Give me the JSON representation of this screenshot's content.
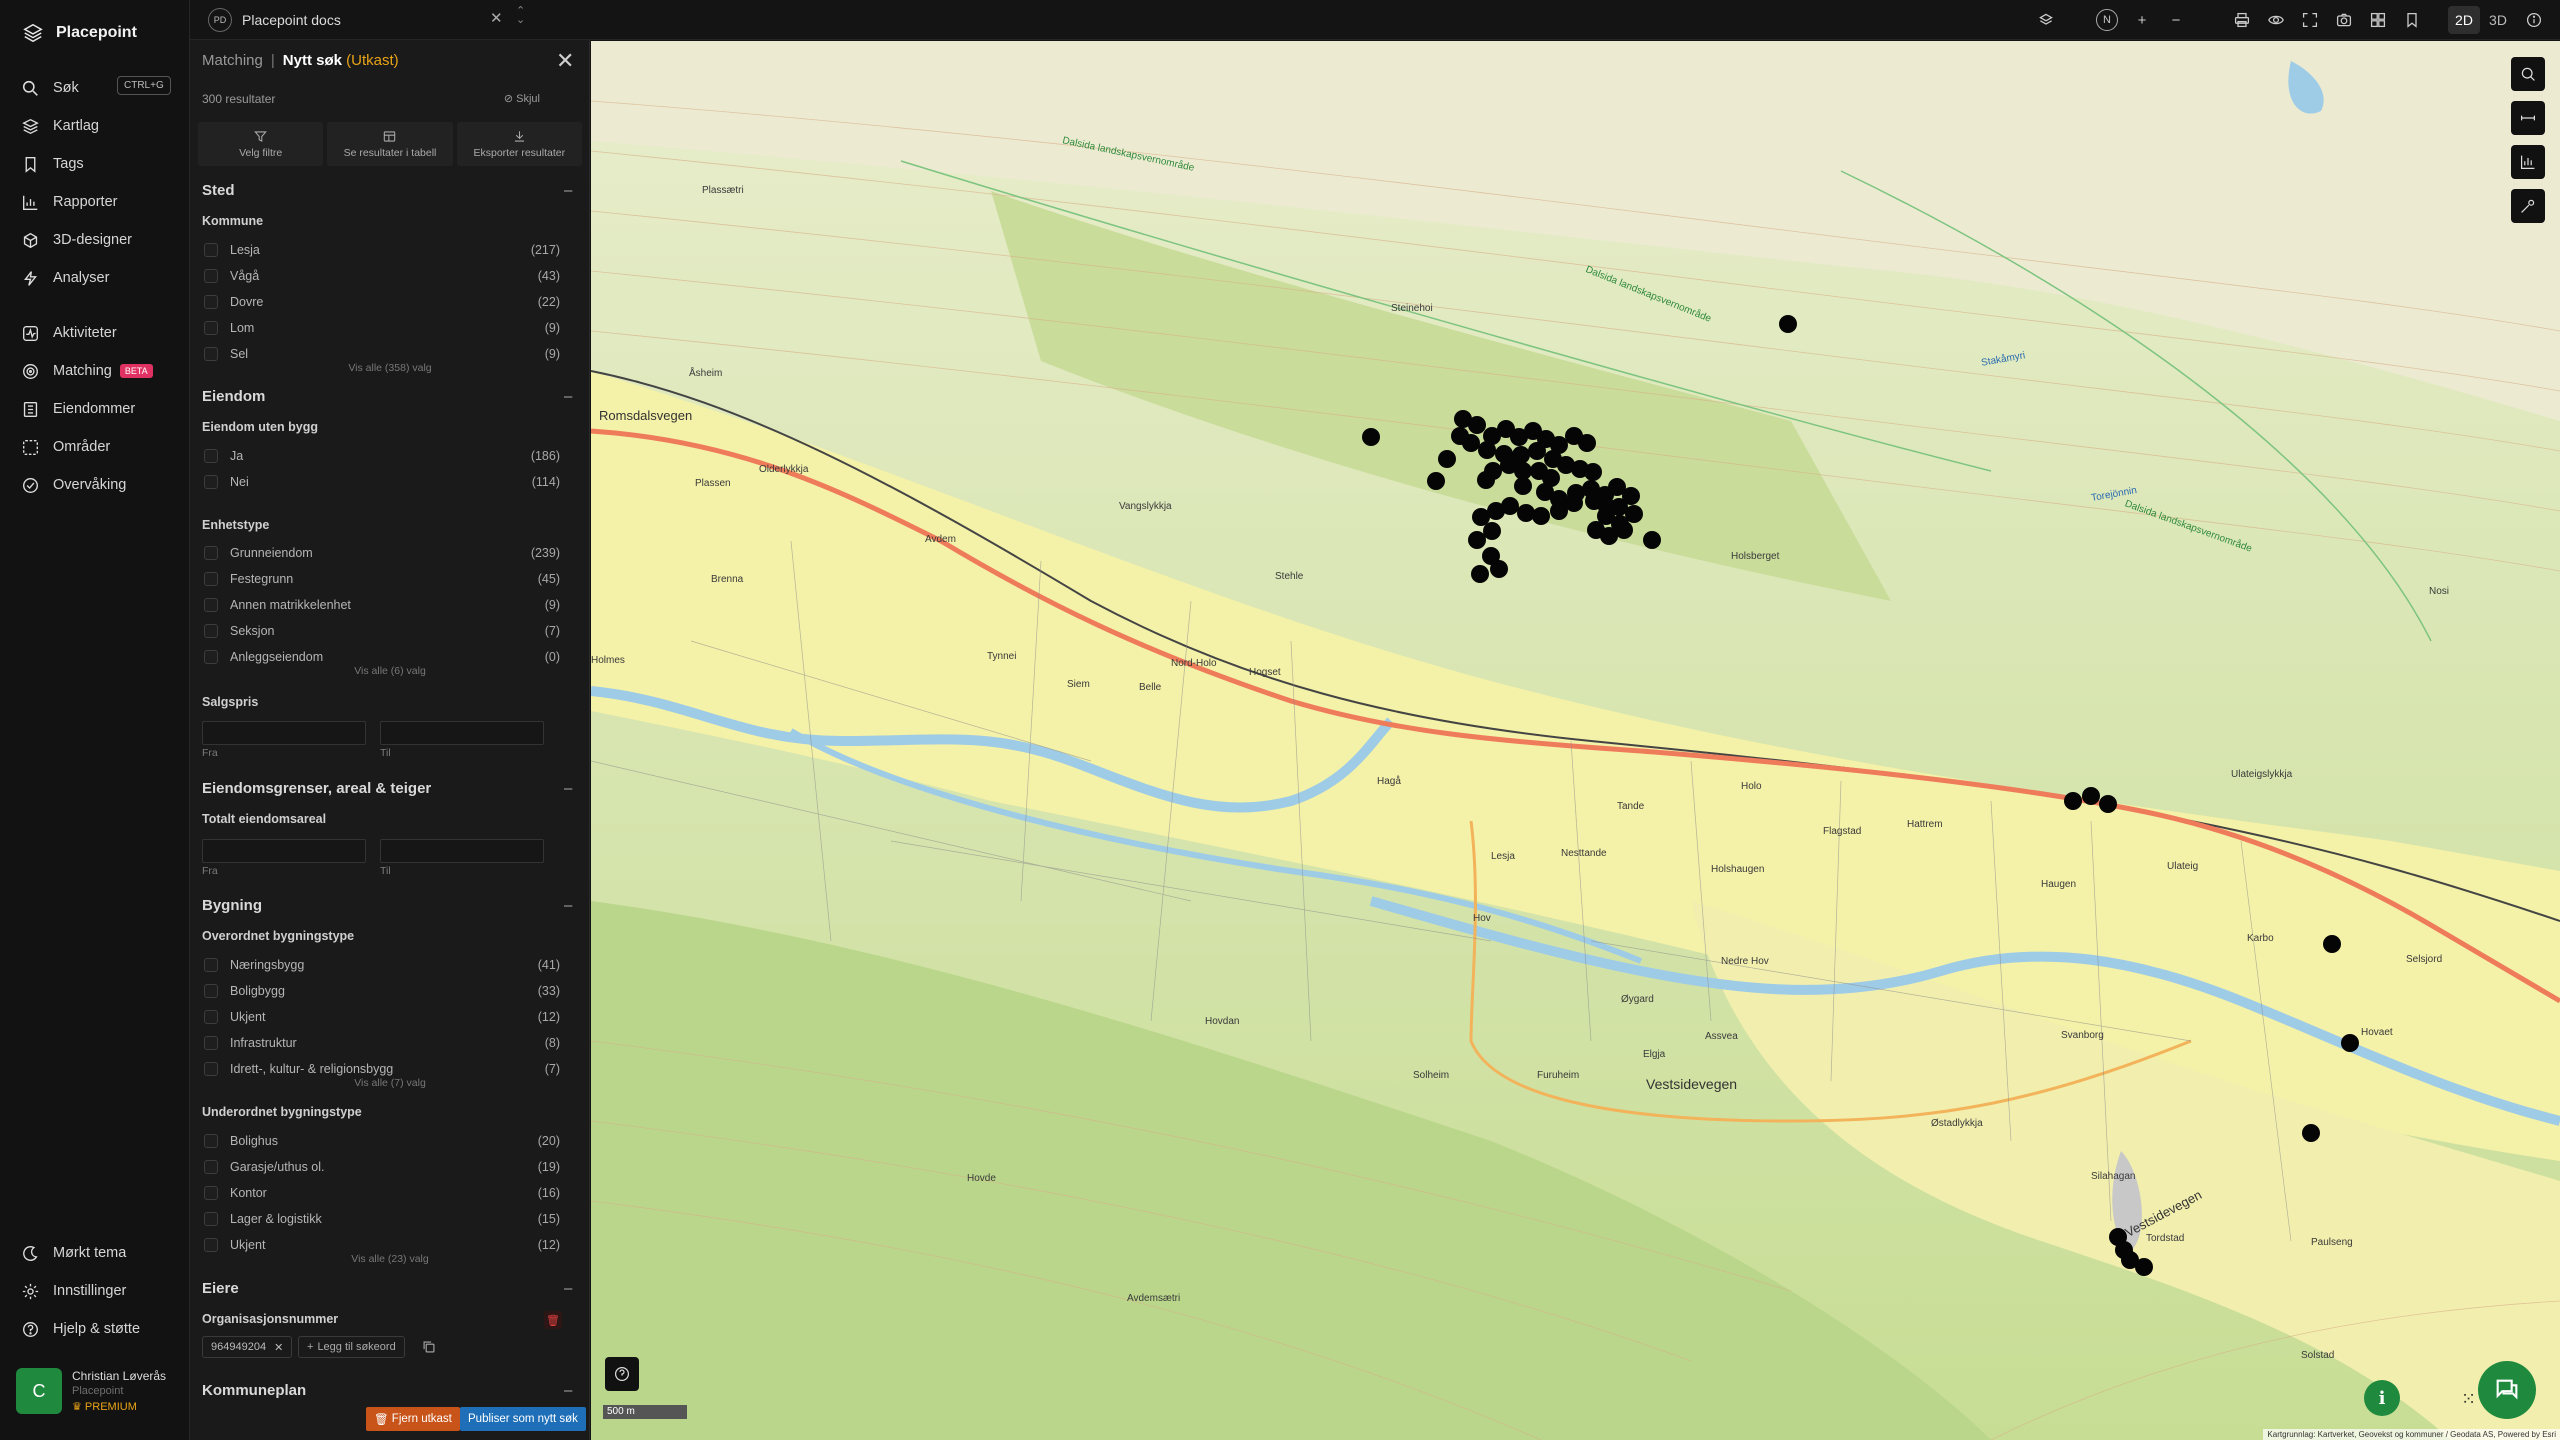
{
  "app": {
    "name": "Placepoint"
  },
  "nav": {
    "items": [
      {
        "label": "Søk",
        "icon": "search-icon",
        "shortcut": "CTRL+G"
      },
      {
        "label": "Kartlag",
        "icon": "layers-icon"
      },
      {
        "label": "Tags",
        "icon": "bookmark-icon"
      },
      {
        "label": "Rapporter",
        "icon": "chart-icon"
      },
      {
        "label": "3D-designer",
        "icon": "cube-icon"
      },
      {
        "label": "Analyser",
        "icon": "bolt-icon"
      },
      {
        "label": "Aktiviteter",
        "icon": "activity-icon"
      },
      {
        "label": "Matching",
        "icon": "target-icon",
        "badge": "BETA"
      },
      {
        "label": "Eiendommer",
        "icon": "building-icon"
      },
      {
        "label": "Områder",
        "icon": "area-icon"
      },
      {
        "label": "Overvåking",
        "icon": "monitor-icon"
      }
    ],
    "bottom": [
      {
        "label": "Mørkt tema",
        "icon": "moon-icon"
      },
      {
        "label": "Innstillinger",
        "icon": "gear-icon"
      },
      {
        "label": "Hjelp & støtte",
        "icon": "help-icon"
      }
    ],
    "user": {
      "initial": "C",
      "name": "Christian Løverås",
      "org": "Placepoint",
      "plan": "PREMIUM"
    }
  },
  "topbar": {
    "workspace_badge": "PD",
    "workspace": "Placepoint docs",
    "compass": "N",
    "mode_2d": "2D",
    "mode_3d": "3D"
  },
  "panel": {
    "crumb_parent": "Matching",
    "crumb_sep": "|",
    "crumb_current": "Nytt søk",
    "crumb_status": "(Utkast)",
    "result_count": "300 resultater",
    "hide_label": "Skjul",
    "actions": [
      "Velg filtre",
      "Se resultater i tabell",
      "Eksporter resultater"
    ],
    "sections": {
      "sted": {
        "title": "Sted",
        "kommune_title": "Kommune",
        "kommune": [
          {
            "label": "Lesja",
            "count": "(217)"
          },
          {
            "label": "Vågå",
            "count": "(43)"
          },
          {
            "label": "Dovre",
            "count": "(22)"
          },
          {
            "label": "Lom",
            "count": "(9)"
          },
          {
            "label": "Sel",
            "count": "(9)"
          }
        ],
        "kommune_more": "Vis alle (358) valg"
      },
      "eiendom": {
        "title": "Eiendom",
        "uten_bygg_title": "Eiendom uten bygg",
        "uten_bygg": [
          {
            "label": "Ja",
            "count": "(186)"
          },
          {
            "label": "Nei",
            "count": "(114)"
          }
        ],
        "enhetstype_title": "Enhetstype",
        "enhetstype": [
          {
            "label": "Grunneiendom",
            "count": "(239)"
          },
          {
            "label": "Festegrunn",
            "count": "(45)"
          },
          {
            "label": "Annen matrikkelenhet",
            "count": "(9)"
          },
          {
            "label": "Seksjon",
            "count": "(7)"
          },
          {
            "label": "Anleggseiendom",
            "count": "(0)"
          }
        ],
        "enhetstype_more": "Vis alle (6) valg",
        "salgspris_title": "Salgspris",
        "from": "Fra",
        "to": "Til"
      },
      "grenser": {
        "title": "Eiendomsgrenser, areal & teiger",
        "areal_title": "Totalt eiendomsareal",
        "from": "Fra",
        "to": "Til"
      },
      "bygning": {
        "title": "Bygning",
        "overordnet_title": "Overordnet bygningstype",
        "overordnet": [
          {
            "label": "Næringsbygg",
            "count": "(41)"
          },
          {
            "label": "Boligbygg",
            "count": "(33)"
          },
          {
            "label": "Ukjent",
            "count": "(12)"
          },
          {
            "label": "Infrastruktur",
            "count": "(8)"
          },
          {
            "label": "Idrett-, kultur- & religionsbygg",
            "count": "(7)"
          }
        ],
        "overordnet_more": "Vis alle (7) valg",
        "underordnet_title": "Underordnet bygningstype",
        "underordnet": [
          {
            "label": "Bolighus",
            "count": "(20)"
          },
          {
            "label": "Garasje/uthus ol.",
            "count": "(19)"
          },
          {
            "label": "Kontor",
            "count": "(16)"
          },
          {
            "label": "Lager & logistikk",
            "count": "(15)"
          },
          {
            "label": "Ukjent",
            "count": "(12)"
          }
        ],
        "underordnet_more": "Vis alle (23) valg"
      },
      "eiere": {
        "title": "Eiere",
        "org_title": "Organisasjonsnummer",
        "chip": "964949204",
        "add_keyword": "Legg til søkeord"
      },
      "kommuneplan": {
        "title": "Kommuneplan"
      }
    },
    "remove_draft": "Fjern utkast",
    "publish": "Publiser som nytt søk"
  },
  "map": {
    "scale": "500 m",
    "attribution": "Kartgrunnlag: Kartverket, Geovekst og kommuner / Geodata AS, Powered by Esri",
    "labels": {
      "romsdalsvegen": "Romsdalsvegen",
      "vestsidevegen": "Vestsidevegen",
      "vestsidevegen2": "Vestsidevegen",
      "lesja": "Lesja",
      "holsberget": "Holsberget",
      "olderlykkja": "Olderlykkja",
      "plassen": "Plassen",
      "avdem": "Avdem",
      "brenna": "Brenna",
      "nordholo": "Nord-Holo",
      "hogset": "Hogset",
      "flagstad": "Flagstad",
      "hattrem": "Hattrem",
      "holshaugen": "Holshaugen",
      "hov": "Hov",
      "hovdan": "Hovdan",
      "solheim": "Solheim",
      "furuheim": "Furuheim",
      "oygard": "Øygard",
      "elgja": "Elgja",
      "svanborg": "Svanborg",
      "ostadlykkja": "Østadlykkja",
      "tordstad": "Tordstad",
      "solstad": "Solstad",
      "hovde": "Hovde",
      "avdemsaetri": "Avdemsætri",
      "nosi": "Nosi",
      "torejornnin": "Torejönnin",
      "ulateigslykkja": "Ulateigslykkja",
      "steinehoi": "Steinehoi",
      "asheim": "Åsheim",
      "plassaetri": "Plassætri",
      "stakamyri": "Stakåmyri",
      "holmes": "Holmes",
      "belle": "Belle",
      "siem": "Siem",
      "hagaa": "Hagå",
      "tande": "Tande",
      "nesttande": "Nesttande",
      "holo": "Holo",
      "nedre_hov": "Nedre Hov",
      "haugen": "Haugen",
      "stehle": "Stehle",
      "vangslykkja": "Vangslykkja",
      "tynnei": "Tynnei",
      "ulateig": "Ulateig",
      "karbo": "Karbo",
      "hovaet": "Hovaet",
      "selsjord": "Selsjord",
      "paulseng": "Paulseng",
      "assvea": "Assvea",
      "silahagan": "Silahagan",
      "dalsida1": "Dalsida landskapsvernområde",
      "dalsida2": "Dalsida landskapsvernområde",
      "dalsida3": "Dalsida landskapsvernområde"
    },
    "markers": [
      {
        "lat_label": "cluster",
        "count": 64
      }
    ]
  }
}
